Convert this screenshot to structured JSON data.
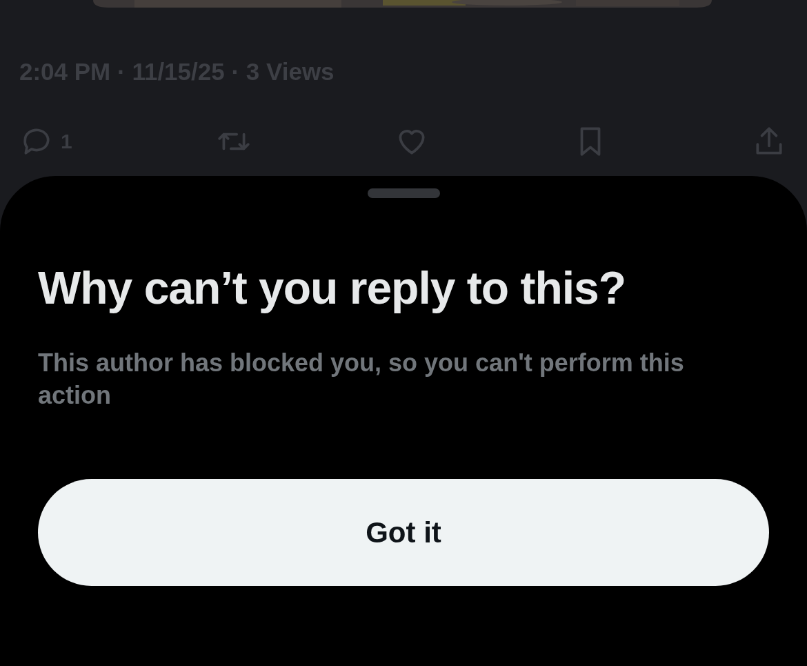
{
  "post": {
    "meta": "2:04 PM · 11/15/25 · 3 Views",
    "actions": [
      {
        "kind": "reply",
        "count": "1"
      },
      {
        "kind": "repost"
      },
      {
        "kind": "like"
      },
      {
        "kind": "bookmark"
      },
      {
        "kind": "share"
      }
    ]
  },
  "sheet": {
    "title": "Why can’t you reply to this?",
    "message": "This author has blocked you, so you can't perform this action",
    "button": "Got it"
  }
}
